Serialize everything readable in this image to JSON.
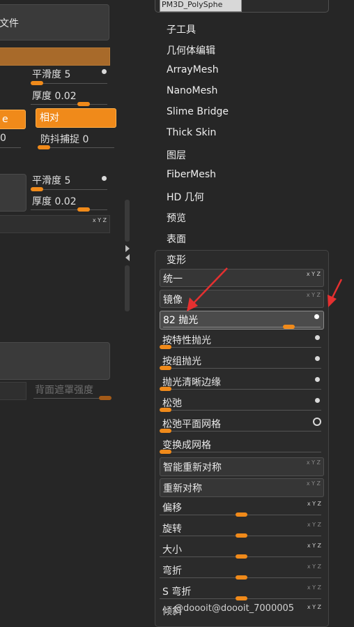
{
  "left": {
    "file_button_label": "文件",
    "group1": {
      "smooth_label": "平滑度 5",
      "thickness_label": "厚度 0.02",
      "chip_label": "e",
      "relative_label": "相对",
      "left_value": "0",
      "anti_snap_label": "防抖捕捉 0"
    },
    "group2": {
      "smooth_label": "平滑度 5",
      "thickness_label": "厚度 0.02"
    },
    "backface_mask_label": "背面遮罩强度"
  },
  "right": {
    "top_field_value": "PM3D_PolySphe",
    "menu_items": [
      "子工具",
      "几何体编辑",
      "ArrayMesh",
      "NanoMesh",
      "Slime Bridge",
      "Thick Skin",
      "图层",
      "FiberMesh",
      "HD 几何",
      "预览",
      "表面",
      "变形"
    ],
    "deform": {
      "unify": "统一",
      "mirror": "镜像",
      "polish": "82 抛光",
      "polish_by_features": "按特性抛光",
      "polish_by_groups": "按组抛光",
      "polish_crisp_edges": "抛光清晰边缘",
      "relax": "松弛",
      "relax_plane_grid": "松弛平面网格",
      "morph_to_grid": "变换成网格",
      "smart_resym": "智能重新对称",
      "resym": "重新对称",
      "offset": "偏移",
      "rotate": "旋转",
      "size": "大小",
      "bend": "弯折",
      "s_bend": "S 弯折",
      "skew": "倾斜"
    },
    "xyz_label": "x Y Z"
  },
  "watermark": "@doooit@doooit_7000005",
  "colors": {
    "background": "#262626",
    "accent_orange": "#f08a1a",
    "annotation_arrow": "#e53030"
  }
}
